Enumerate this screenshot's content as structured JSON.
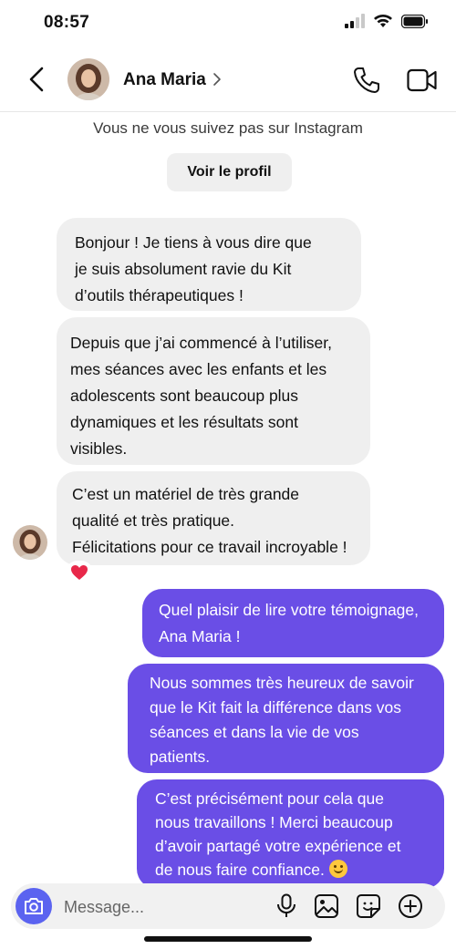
{
  "status_bar": {
    "time": "08:57"
  },
  "header": {
    "contact_name": "Ana Maria"
  },
  "notice": {
    "text": "Vous ne vous suivez pas sur Instagram",
    "profile_button": "Voir le profil"
  },
  "messages": {
    "incoming": [
      {
        "lines": [
          " Bonjour ! Je tiens à vous dire que",
          "je suis absolument ravie du Kit",
          "d’outils thérapeutiques !"
        ]
      },
      {
        "lines": [
          "Depuis que j’ai commencé à l’utiliser,",
          "mes séances avec les enfants et les",
          "adolescents sont beaucoup plus",
          "dynamiques et les résultats sont",
          "visibles."
        ]
      },
      {
        "lines": [
          " C’est un matériel de très grande",
          "qualité et très pratique.",
          "Félicitations pour ce travail incroyable !"
        ],
        "reaction": "heart"
      }
    ],
    "outgoing": [
      {
        "lines": [
          "Quel plaisir de lire votre témoignage,",
          "Ana Maria !"
        ]
      },
      {
        "lines": [
          "Nous sommes très heureux de savoir",
          "que le Kit fait la différence dans vos",
          "séances et dans la vie de vos",
          "patients."
        ]
      },
      {
        "lines": [
          "C’est précisément pour cela que",
          "nous travaillons ! Merci beaucoup",
          "d’avoir partagé votre expérience et",
          "de nous faire confiance."
        ],
        "emoji": "smiling-face"
      }
    ]
  },
  "composer": {
    "placeholder": "Message..."
  },
  "colors": {
    "outgoing_bubble": "#6a4ee6",
    "incoming_bubble": "#efefef",
    "camera_button": "#5b63f0",
    "reaction_heart": "#e8284a"
  }
}
